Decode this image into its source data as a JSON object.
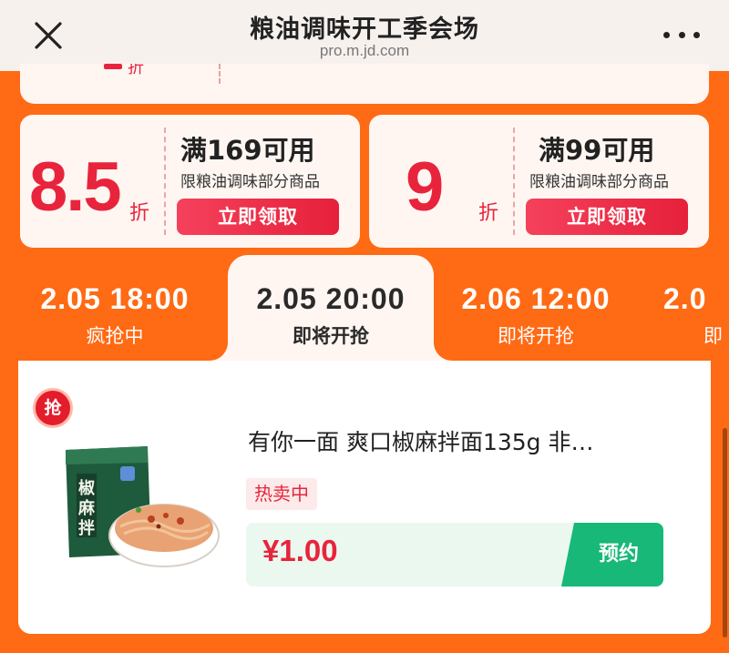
{
  "header": {
    "title": "粮油调味开工季会场",
    "url": "pro.m.jd.com"
  },
  "top_card": {
    "partial_zhe": "折"
  },
  "coupons": [
    {
      "discount": "8.5",
      "unit": "折",
      "condition": "满169可用",
      "scope": "限粮油调味部分商品",
      "button": "立即领取"
    },
    {
      "discount": "9",
      "unit": "折",
      "condition": "满99可用",
      "scope": "限粮油调味部分商品",
      "button": "立即领取"
    }
  ],
  "tabs": [
    {
      "time": "2.05 18:00",
      "state": "疯抢中"
    },
    {
      "time": "2.05 20:00",
      "state": "即将开抢",
      "active": true
    },
    {
      "time": "2.06 12:00",
      "state": "即将开抢"
    },
    {
      "time": "2.0",
      "state": "即"
    }
  ],
  "product": {
    "badge": "抢",
    "name": "有你一面 爽口椒麻拌面135g 非…",
    "tag": "热卖中",
    "price": "¥1.00",
    "action": "预约",
    "package_text": "椒麻拌面"
  },
  "colors": {
    "page_bg": "#ff6a14",
    "accent_red": "#e8243c",
    "reserve_green": "#17b878"
  }
}
